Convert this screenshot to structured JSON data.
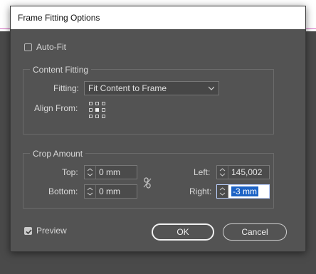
{
  "dialog": {
    "title": "Frame Fitting Options"
  },
  "auto_fit": {
    "label": "Auto-Fit",
    "checked": false
  },
  "content_fitting": {
    "group_label": "Content Fitting",
    "fitting_label": "Fitting:",
    "fitting_value": "Fit Content to Frame",
    "align_from_label": "Align From:",
    "align_from_selected": "center"
  },
  "crop_amount": {
    "group_label": "Crop Amount",
    "top_label": "Top:",
    "top_value": "0 mm",
    "bottom_label": "Bottom:",
    "bottom_value": "0 mm",
    "left_label": "Left:",
    "left_value": "145,002",
    "right_label": "Right:",
    "right_value": "-3 mm"
  },
  "preview": {
    "label": "Preview",
    "checked": true
  },
  "buttons": {
    "ok": "OK",
    "cancel": "Cancel"
  },
  "colors": {
    "dialog_bg": "#535353",
    "selection": "#1c62c5",
    "accent_line": "#d66fc4"
  }
}
